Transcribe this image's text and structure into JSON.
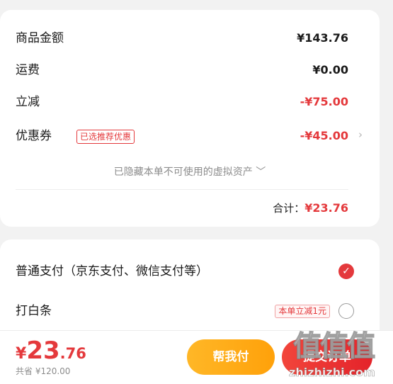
{
  "summary": {
    "rows": [
      {
        "label": "商品金额",
        "value": "¥143.76"
      },
      {
        "label": "运费",
        "value": "¥0.00"
      },
      {
        "label": "立减",
        "value": "-¥75.00"
      },
      {
        "label": "优惠券",
        "value": "-¥45.00",
        "tag": "已选推荐优惠",
        "chevron": "›"
      }
    ],
    "hidden_note": "已隐藏本单不可使用的虚拟资产",
    "hidden_note_icon": "﹀",
    "total_label": "合计：",
    "total_value": "¥23.76"
  },
  "payment": {
    "options": [
      {
        "label": "普通支付（京东支付、微信支付等）",
        "selected": true
      },
      {
        "label": "打白条",
        "selected": false,
        "tag": "本单立减1元"
      }
    ]
  },
  "bottom": {
    "currency": "¥",
    "price_int": "23",
    "price_dec": ".76",
    "saved": "共省 ¥120.00",
    "help_pay_label": "帮我付",
    "submit_label": "提交订单"
  },
  "watermark": {
    "logo": "值值值",
    "url": "zhizhizhi.com"
  },
  "colors": {
    "accent_red": "#e4393c",
    "help_pay_orange": "#ffa10a",
    "background": "#f2f2f2"
  }
}
